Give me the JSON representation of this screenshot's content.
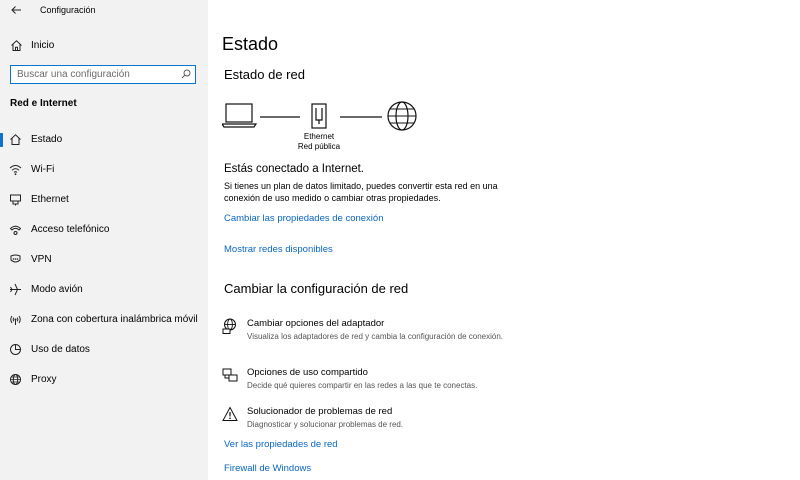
{
  "window": {
    "title": "Configuración"
  },
  "sidebar": {
    "home_label": "Inicio",
    "search_placeholder": "Buscar una configuración",
    "section_title": "Red e Internet",
    "items": [
      {
        "label": "Estado",
        "icon": "home-status-icon"
      },
      {
        "label": "Wi-Fi",
        "icon": "wifi-icon"
      },
      {
        "label": "Ethernet",
        "icon": "ethernet-icon"
      },
      {
        "label": "Acceso telefónico",
        "icon": "dialup-icon"
      },
      {
        "label": "VPN",
        "icon": "vpn-icon"
      },
      {
        "label": "Modo avión",
        "icon": "airplane-icon"
      },
      {
        "label": "Zona con cobertura inalámbrica móvil",
        "icon": "hotspot-icon"
      },
      {
        "label": "Uso de datos",
        "icon": "data-usage-icon"
      },
      {
        "label": "Proxy",
        "icon": "globe-icon"
      }
    ],
    "active_index": 0
  },
  "main": {
    "title": "Estado",
    "network_status_heading": "Estado de red",
    "diagram": {
      "adapter_name": "Ethernet",
      "network_type": "Red pública"
    },
    "connected_text": "Estás conectado a Internet.",
    "connected_desc": "Si tienes un plan de datos limitado, puedes convertir esta red en una conexión de uso medido o cambiar otras propiedades.",
    "link_change_props": "Cambiar las propiedades de conexión",
    "link_show_networks": "Mostrar redes disponibles",
    "change_settings_heading": "Cambiar la configuración de red",
    "options": [
      {
        "title": "Cambiar opciones del adaptador",
        "desc": "Visualiza los adaptadores de red y cambia la configuración de conexión.",
        "icon": "adapter-icon"
      },
      {
        "title": "Opciones de uso compartido",
        "desc": "Decide qué quieres compartir en las redes a las que te conectas.",
        "icon": "sharing-icon"
      },
      {
        "title": "Solucionador de problemas de red",
        "desc": "Diagnosticar y solucionar problemas de red.",
        "icon": "warning-icon"
      }
    ],
    "link_view_props": "Ver las propiedades de red",
    "link_firewall": "Firewall de Windows"
  },
  "colors": {
    "accent": "#0a74d0",
    "link": "#0a66c2",
    "sidebar_bg": "#f2f2f2"
  }
}
